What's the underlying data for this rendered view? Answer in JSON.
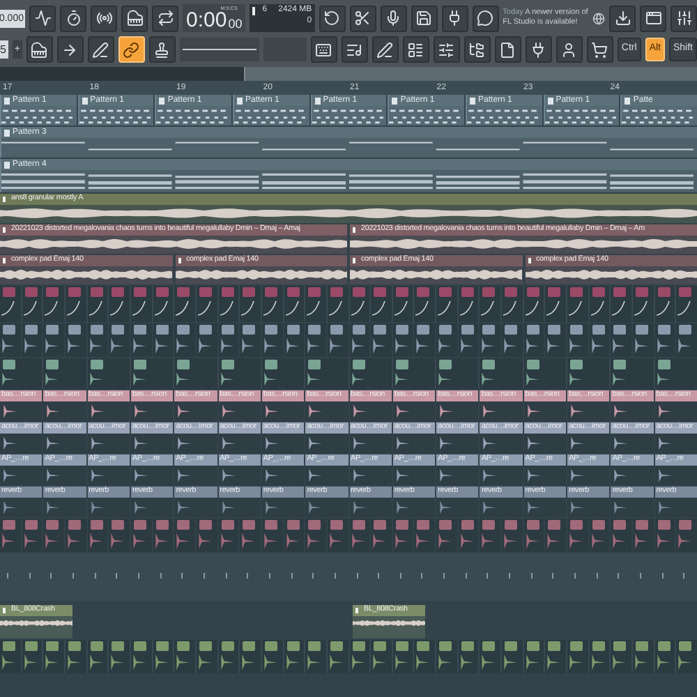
{
  "toolbar": {
    "tempo": "0.000",
    "pattern_number": "5",
    "pattern_add": "+",
    "time": "0:00",
    "time_cs": "00",
    "time_unit": "M:S:CS",
    "cpu": "6",
    "memory": "2424 MB",
    "polyphony": "0",
    "hint_day": "Today",
    "hint_text": "A newer version of FL Studio is available!",
    "tools": [
      {
        "kind": "piano",
        "selected": false
      },
      {
        "kind": "arrow",
        "selected": false
      },
      {
        "kind": "pen",
        "selected": false
      },
      {
        "kind": "link",
        "selected": true
      },
      {
        "kind": "stamp",
        "selected": false
      }
    ],
    "modifiers": [
      {
        "label": "Ctrl",
        "selected": false
      },
      {
        "label": "Alt",
        "selected": true
      },
      {
        "label": "Shift",
        "selected": false
      }
    ]
  },
  "ruler": [
    "17",
    "18",
    "19",
    "20",
    "21",
    "22",
    "23",
    "24"
  ],
  "tracks": [
    {
      "kind": "pattern-notes",
      "color": "#566a75",
      "clips": [
        "Pattern 1",
        "Pattern 1",
        "Pattern 1",
        "Pattern 1",
        "Pattern 1",
        "Pattern 1",
        "Pattern 1",
        "Pattern 1",
        "Patte"
      ]
    },
    {
      "kind": "pattern-lines",
      "color": "#4e6069",
      "clips": [
        "Pattern 3"
      ]
    },
    {
      "kind": "pattern-chords",
      "color": "#4e6069",
      "clips": [
        "Pattern 4"
      ]
    },
    {
      "kind": "audio",
      "color": "#6f7a58",
      "clips": [
        "ans8 granular mostly A"
      ]
    },
    {
      "kind": "audio",
      "color": "#7e5f64",
      "clips": [
        "20221023 distorted megalovania chaos turns into beautiful megalullaby Dmin – Dmaj – Amaj",
        "20221023 distorted megalovania chaos turns into beautiful megalullaby Dmin – Dmaj – Am"
      ]
    },
    {
      "kind": "audio",
      "color": "#745a60",
      "clips": [
        "complex pad Emaj 140",
        "complex pad Emaj 140",
        "complex pad Emaj 140",
        "complex pad Emaj 140"
      ]
    },
    {
      "kind": "automation",
      "color": "#9a4a66"
    },
    {
      "kind": "hits",
      "color": "#8a9aac"
    },
    {
      "kind": "hits-sparse",
      "color": "#7aa594"
    },
    {
      "kind": "labeled",
      "color": "#c99aa6",
      "clips": [
        "bas…rsion",
        "bas…rsion",
        "bas…rsion",
        "bas…rsion",
        "bas…rsion",
        "bas…rsion",
        "bas…rsion",
        "bas…rsion",
        "bas…rsion",
        "bas…rsion",
        "bas…rsion",
        "bas…rsion",
        "bas…rsion",
        "bas…rsion",
        "bas…rsion",
        "bas…rsion"
      ]
    },
    {
      "kind": "labeled",
      "color": "#9aa4b8",
      "clips": [
        "acou…imor",
        "acou…imor",
        "acou…imor",
        "acou…imor",
        "acou…imor",
        "acou…imor",
        "acou…imor",
        "acou…imor",
        "acou…imor",
        "acou…imor",
        "acou…imor",
        "acou…imor",
        "acou…imor",
        "acou…imor",
        "acou…imor",
        "acou…imor"
      ]
    },
    {
      "kind": "labeled",
      "color": "#8e9db0",
      "clips": [
        "AP_…re",
        "AP_…re",
        "AP_…re",
        "AP_…re",
        "AP_…re",
        "AP_…re",
        "AP_…re",
        "AP_…re",
        "AP_…re",
        "AP_…re",
        "AP_…re",
        "AP_…re",
        "AP_…re",
        "AP_…re",
        "AP_…re",
        "AP_…re"
      ]
    },
    {
      "kind": "labeled",
      "color": "#7c8a9c",
      "clips": [
        "reverb",
        "reverb",
        "reverb",
        "reverb",
        "reverb",
        "reverb",
        "reverb",
        "reverb",
        "reverb",
        "reverb",
        "reverb",
        "reverb",
        "reverb",
        "reverb",
        "reverb",
        "reverb"
      ]
    },
    {
      "kind": "hits",
      "color": "#a06a7a"
    },
    {
      "kind": "ticks",
      "color": "#8a9aa4"
    },
    {
      "kind": "short-audio",
      "color": "#7b8c68",
      "clips": [
        "BL_808Crash",
        "BL_808Crash"
      ]
    },
    {
      "kind": "hits",
      "color": "#7d9a6c"
    }
  ]
}
